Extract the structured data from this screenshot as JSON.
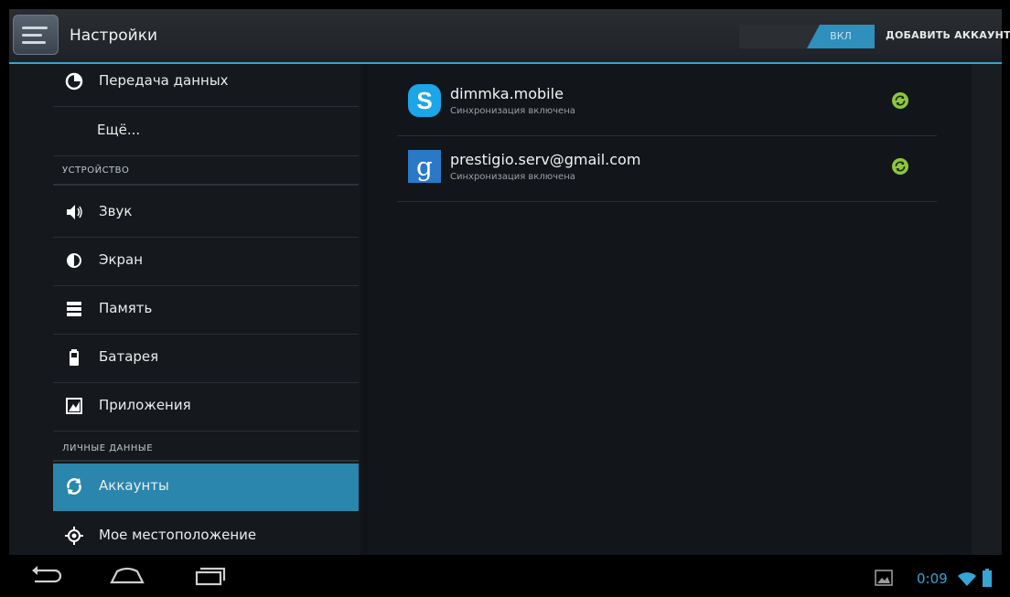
{
  "actionbar": {
    "title": "Настройки",
    "toggle_label": "ВКЛ",
    "add_account_label": "ДОБАВИТЬ АККАУНТ"
  },
  "sidebar": {
    "items": [
      {
        "label": "Передача данных",
        "icon": "data-usage-icon"
      },
      {
        "label": "Ещё...",
        "icon": ""
      },
      {
        "label": "Звук",
        "icon": "volume-icon"
      },
      {
        "label": "Экран",
        "icon": "brightness-icon"
      },
      {
        "label": "Память",
        "icon": "storage-icon"
      },
      {
        "label": "Батарея",
        "icon": "battery-icon"
      },
      {
        "label": "Приложения",
        "icon": "apps-icon"
      },
      {
        "label": "Аккаунты",
        "icon": "sync-icon",
        "active": true
      },
      {
        "label": "Мое местоположение",
        "icon": "location-icon"
      }
    ],
    "sections": {
      "device": "УСТРОЙСТВО",
      "personal": "ЛИЧНЫЕ ДАННЫЕ"
    }
  },
  "accounts": [
    {
      "name": "dimmka.mobile",
      "status": "Синхронизация включена",
      "icon": "skype-icon"
    },
    {
      "name": "prestigio.serv@gmail.com",
      "status": "Синхронизация включена",
      "icon": "google-icon"
    }
  ],
  "status": {
    "time": "0:09"
  },
  "colors": {
    "accent": "#2a86ad",
    "sync_green": "#8dc63f",
    "time_blue": "#37a4d4"
  }
}
